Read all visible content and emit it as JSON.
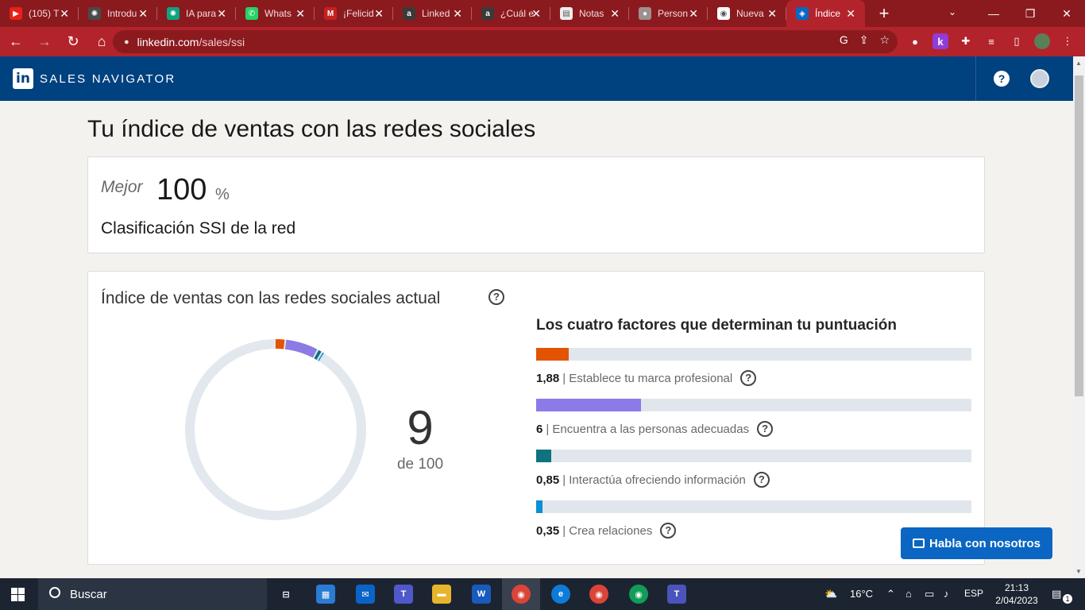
{
  "browser": {
    "tabs": [
      {
        "title": "(105) T",
        "fav_color": "#e62117",
        "fav_glyph": "▶"
      },
      {
        "title": "Introdu",
        "fav_color": "#4a4a4a",
        "fav_glyph": "✺"
      },
      {
        "title": "IA para",
        "fav_color": "#10a37f",
        "fav_glyph": "✺"
      },
      {
        "title": "Whats",
        "fav_color": "#25d366",
        "fav_glyph": "✆"
      },
      {
        "title": "¡Felicid",
        "fav_color": "#c5221f",
        "fav_glyph": "M"
      },
      {
        "title": "Linked",
        "fav_color": "#3a3a3a",
        "fav_glyph": "a"
      },
      {
        "title": "¿Cuál e",
        "fav_color": "#3a3a3a",
        "fav_glyph": "a"
      },
      {
        "title": "Notas",
        "fav_color": "#eeeeee",
        "fav_glyph": "▤"
      },
      {
        "title": "Person",
        "fav_color": "#9e8f8f",
        "fav_glyph": "●"
      },
      {
        "title": "Nueva",
        "fav_color": "#ffffff",
        "fav_glyph": "◉"
      },
      {
        "title": "Índice",
        "fav_color": "#0a66c2",
        "fav_glyph": "◈"
      }
    ],
    "close_glyph": "✕",
    "newtab_glyph": "+",
    "tabsearch_glyph": "⌄",
    "min_glyph": "—",
    "restore_glyph": "❐",
    "close_window_glyph": "✕",
    "back_glyph": "←",
    "forward_glyph": "→",
    "reload_glyph": "↻",
    "home_glyph": "⌂",
    "url_host": "linkedin.com",
    "url_path": "/sales/ssi",
    "lock_glyph": "🔒"
  },
  "header": {
    "logo": "in",
    "brand": "SALES NAVIGATOR",
    "help": "?"
  },
  "page": {
    "title": "Tu índice de ventas con las redes sociales",
    "rank": {
      "label": "Mejor",
      "value": "100",
      "unit": "%",
      "caption": "Clasificación SSI de la red"
    },
    "ssi": {
      "title": "Índice de ventas con las redes sociales actual",
      "score": "9",
      "score_of": "de 100",
      "factors_title": "Los cuatro factores que determinan tu puntuación",
      "factors": [
        {
          "value": "1,88",
          "label": "| Establece tu marca profesional",
          "level": 1.88,
          "max": 25,
          "color": "#e35400"
        },
        {
          "value": "6",
          "label": "| Encuentra a las personas adecuadas",
          "level": 6,
          "max": 25,
          "color": "#8c7ae6"
        },
        {
          "value": "0,85",
          "label": "| Interactúa ofreciendo información",
          "level": 0.85,
          "max": 25,
          "color": "#0f7280"
        },
        {
          "value": "0,35",
          "label": "| Crea relaciones",
          "level": 0.35,
          "max": 25,
          "color": "#0b8fd6"
        }
      ]
    },
    "chat_button": "Habla con nosotros"
  },
  "taskbar": {
    "search": "Buscar",
    "weather": "16°C",
    "lang": "ESP",
    "time": "21:13",
    "date": "2/04/2023",
    "notif": "1"
  }
}
